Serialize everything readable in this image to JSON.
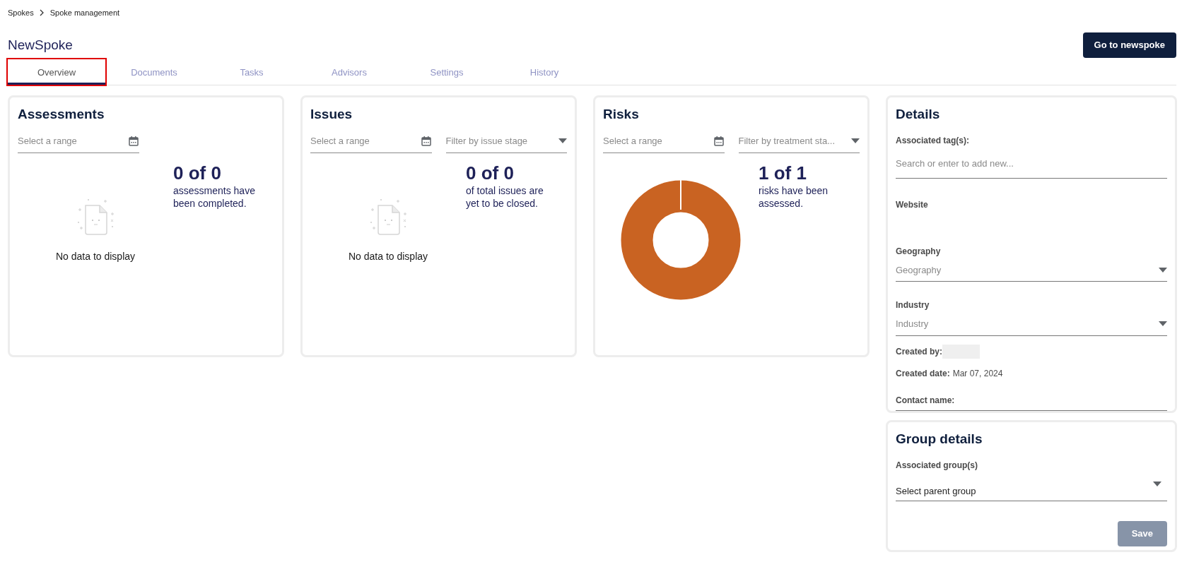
{
  "breadcrumb": [
    {
      "label": "Spokes"
    },
    {
      "label": "Spoke management"
    }
  ],
  "title": "NewSpoke",
  "header_button": "Go to newspoke",
  "tabs": [
    {
      "label": "Overview",
      "selected": true,
      "highlighted": true
    },
    {
      "label": "Documents",
      "selected": false,
      "highlighted": false
    },
    {
      "label": "Tasks",
      "selected": false,
      "highlighted": false
    },
    {
      "label": "Advisors",
      "selected": false,
      "highlighted": false
    },
    {
      "label": "Settings",
      "selected": false,
      "highlighted": false
    },
    {
      "label": "History",
      "selected": false,
      "highlighted": false
    }
  ],
  "cards": [
    {
      "kind": "empty",
      "title": "Assessments",
      "range_placeholder": "Select a range",
      "stat": "0 of 0",
      "stat_caption": "assessments have been completed.",
      "empty_text": "No data to display"
    },
    {
      "kind": "empty",
      "title": "Issues",
      "range_placeholder": "Select a range",
      "filter_placeholder": "Filter by issue stage",
      "stat": "0 of 0",
      "stat_caption": "of total issues are yet to be closed.",
      "empty_text": "No data to display"
    },
    {
      "kind": "donut",
      "title": "Risks",
      "range_placeholder": "Select a range",
      "filter_placeholder": "Filter by treatment sta...",
      "stat": "1 of 1",
      "stat_caption": "risks have been assessed."
    }
  ],
  "details": {
    "title": "Details",
    "tags_label": "Associated tag(s):",
    "tags_placeholder": "Search or enter to add new...",
    "website_label": "Website",
    "geography_label": "Geography",
    "geography_placeholder": "Geography",
    "industry_label": "Industry",
    "industry_placeholder": "Industry",
    "created_by_label": "Created by:",
    "created_date_label": "Created date:",
    "created_date": "Mar 07, 2024",
    "contact_label": "Contact name:"
  },
  "group_details": {
    "title": "Group details",
    "groups_label": "Associated group(s)",
    "parent_value": "Select parent group",
    "save_button": "Save"
  }
}
